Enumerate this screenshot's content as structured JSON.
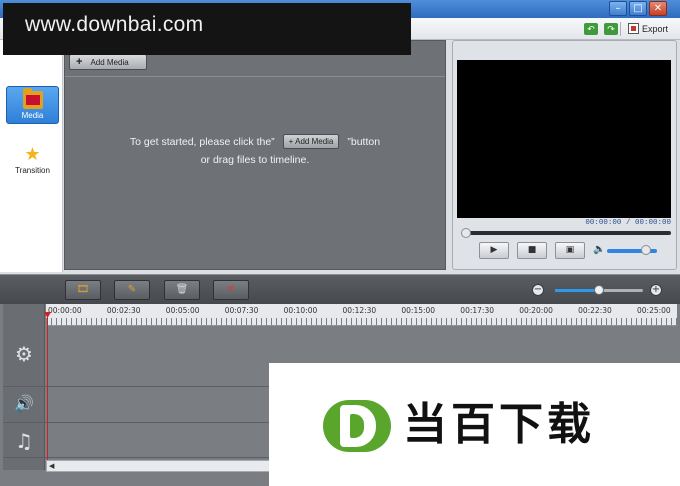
{
  "toolbar": {
    "undo_icon": "undo-icon",
    "redo_icon": "redo-icon",
    "export_label": "Export"
  },
  "window_controls": {
    "minimize": "–",
    "maximize": "□",
    "close": "✕"
  },
  "watermark_top": {
    "text": "www.downbai.com"
  },
  "sidebar": {
    "items": [
      {
        "label": "Media",
        "icon": "folder-icon",
        "active": true
      },
      {
        "label": "Transition",
        "icon": "star-icon",
        "active": false
      }
    ]
  },
  "media": {
    "add_button_label": "Add Media",
    "hint_before": "To get started, please click the”",
    "hint_button": "Add Media",
    "hint_after": "”button",
    "hint_line2": "or drag files to timeline."
  },
  "preview": {
    "current_time": "00:00:00",
    "separator": "/",
    "total_time": "00:00:00",
    "seek_position": 0,
    "volume_level": 0.78,
    "play_icon": "play-icon",
    "stop_icon": "stop-icon",
    "fullscreen_icon": "fullscreen-icon",
    "volume_icon": "speaker-icon"
  },
  "timeline_toolbar": {
    "buttons": [
      "film-clip-icon",
      "edit-clip-icon",
      "trash-icon",
      "delete-icon"
    ],
    "zoom_level": 0.5
  },
  "timeline": {
    "ruler_labels": [
      "00:00:00",
      "00:02:30",
      "00:05:00",
      "00:07:30",
      "00:10:00",
      "00:12:30",
      "00:15:00",
      "00:17:30",
      "00:20:00",
      "00:22:30",
      "00:25:00"
    ],
    "tracks": [
      "video-track-icon",
      "audio-track-icon",
      "music-track-icon"
    ]
  },
  "watermark_bottom": {
    "text": "当百下载"
  },
  "colors": {
    "accent_blue": "#2f7fd8",
    "panel_gray": "#6e7176",
    "playhead_red": "#d21f1f",
    "watermark_green": "#5aa62c"
  }
}
